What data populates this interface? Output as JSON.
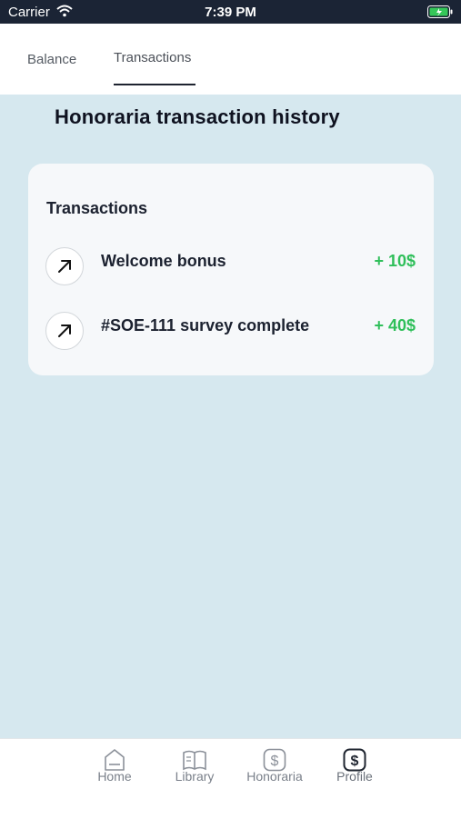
{
  "status_bar": {
    "carrier": "Carrier",
    "time": "7:39 PM"
  },
  "tabs": [
    {
      "label": "Balance"
    },
    {
      "label": "Transactions"
    }
  ],
  "page_title": "Honoraria transaction history",
  "card": {
    "title": "Transactions",
    "items": [
      {
        "label": "Welcome bonus",
        "amount": "+ 10$"
      },
      {
        "label": "#SOE-111 survey complete",
        "amount": "+ 40$"
      }
    ]
  },
  "bottom_nav": [
    {
      "label": "Home",
      "icon": "home-icon"
    },
    {
      "label": "Library",
      "icon": "library-icon"
    },
    {
      "label": "Honoraria",
      "icon": "dollar-icon"
    },
    {
      "label": "Profile",
      "icon": "dollar-icon"
    }
  ],
  "colors": {
    "background": "#d6e8ef",
    "status_bar": "#1b2435",
    "amount_green": "#2fbf5a",
    "battery_green": "#35c759"
  }
}
